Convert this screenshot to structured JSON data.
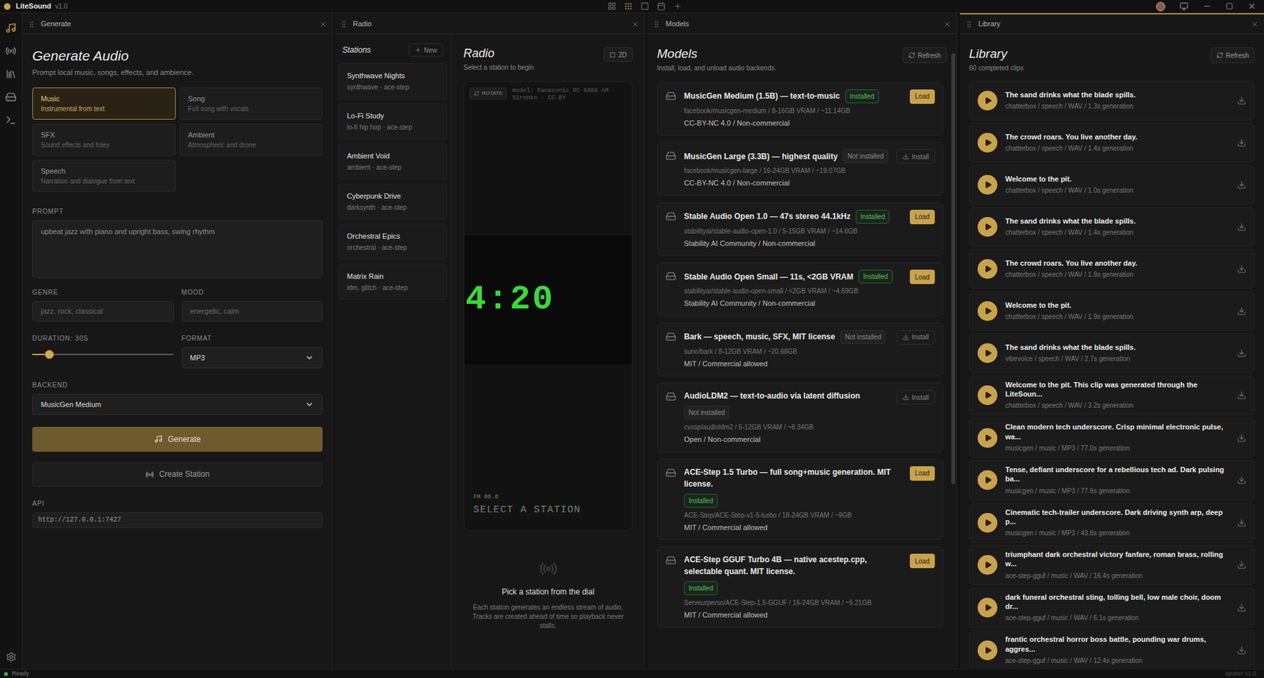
{
  "window": {
    "title": "LiteSound",
    "version": "v1.0"
  },
  "layout_buttons": [
    {
      "selected": false
    },
    {
      "selected": true
    },
    {
      "selected": false
    },
    {
      "selected": false
    },
    {
      "selected": false
    }
  ],
  "rail": {
    "items": [
      {
        "selected": true
      },
      {
        "selected": false
      },
      {
        "selected": false
      },
      {
        "selected": false
      },
      {
        "selected": false
      }
    ]
  },
  "generate": {
    "panel_title": "Generate",
    "focused": false,
    "title": "Generate Audio",
    "subtitle": "Prompt local music, songs, effects, and ambience.",
    "modes": [
      {
        "label": "Music",
        "hint": "Instrumental from text",
        "selected": true
      },
      {
        "label": "Song",
        "hint": "Full song with vocals",
        "selected": false
      },
      {
        "label": "SFX",
        "hint": "Sound effects and foley",
        "selected": false
      },
      {
        "label": "Ambient",
        "hint": "Atmospheric and drone",
        "selected": false
      },
      {
        "label": "Speech",
        "hint": "Narration and dialogue from text",
        "selected": false
      }
    ],
    "prompt": {
      "label": "PROMPT",
      "placeholder": "upbeat jazz with piano and upright bass, swing rhythm"
    },
    "genre": {
      "label": "GENRE",
      "placeholder": "jazz, rock, classical"
    },
    "mood": {
      "label": "MOOD",
      "placeholder": "energetic, calm"
    },
    "duration": {
      "label": "DURATION: 30S",
      "level": 0.12
    },
    "format": {
      "label": "FORMAT",
      "value": "MP3"
    },
    "backend": {
      "label": "BACKEND",
      "value": "MusicGen Medium"
    },
    "generate_button": "Generate",
    "station_button": "Create Station",
    "api": {
      "label": "API",
      "value": "http://127.0.0.1:7427"
    }
  },
  "radio": {
    "panel_title": "Radio",
    "focused": false,
    "stations_title": "Stations",
    "new_button": "New",
    "stations": [
      {
        "name": "Synthwave Nights",
        "meta": "synthwave · ace-step",
        "selected": false
      },
      {
        "name": "Lo-Fi Study",
        "meta": "lo-fi hip hop · ace-step",
        "selected": false
      },
      {
        "name": "Ambient Void",
        "meta": "ambient · ace-step",
        "selected": false
      },
      {
        "name": "Cyberpunk Drive",
        "meta": "darksynth · ace-step",
        "selected": false
      },
      {
        "name": "Orchestral Epics",
        "meta": "orchestral · ace-step",
        "selected": false
      },
      {
        "name": "Matrix Rain",
        "meta": "idm, glitch · ace-step",
        "selected": false
      }
    ],
    "title": "Radio",
    "subtitle": "Select a station to begin",
    "view_button": "2D",
    "rotate_button": "ROTATE",
    "credit": "model: Panasonic RC 6088 AM · Sirenko · CC-BY",
    "clock": "4:20",
    "frequency": "FM 00.0",
    "status": "SELECT A STATION",
    "empty_title": "Pick a station from the dial",
    "empty_text": "Each station generates an endless stream of audio. Tracks are created ahead of time so playback never stalls."
  },
  "models": {
    "panel_title": "Models",
    "focused": false,
    "title": "Models",
    "subtitle": "Install, load, and unload audio backends.",
    "refresh": "Refresh",
    "scroll_level": 0.7,
    "items": [
      {
        "name": "MusicGen Medium (1.5B) — text-to-music",
        "installed": true,
        "badge": "Installed",
        "repo": "facebook/musicgen-medium / 8-16GB VRAM / ~11.14GB",
        "license": "CC-BY-NC 4.0 / Non-commercial",
        "action": "Load"
      },
      {
        "name": "MusicGen Large (3.3B) — highest quality",
        "installed": false,
        "badge": "Not installed",
        "repo": "facebook/musicgen-large / 16-24GB VRAM / ~19.07GB",
        "license": "CC-BY-NC 4.0 / Non-commercial",
        "action": "Install"
      },
      {
        "name": "Stable Audio Open 1.0 — 47s stereo 44.1kHz",
        "installed": true,
        "badge": "Installed",
        "repo": "stabilityai/stable-audio-open-1.0 / 5-15GB VRAM / ~14.6GB",
        "license": "Stability AI Community / Non-commercial",
        "action": "Load"
      },
      {
        "name": "Stable Audio Open Small — 11s, <2GB VRAM",
        "installed": true,
        "badge": "Installed",
        "repo": "stabilityai/stable-audio-open-small / <2GB VRAM / ~4.69GB",
        "license": "Stability AI Community / Non-commercial",
        "action": "Load"
      },
      {
        "name": "Bark — speech, music, SFX, MIT license",
        "installed": false,
        "badge": "Not installed",
        "repo": "suno/bark / 8-12GB VRAM / ~20.68GB",
        "license": "MIT / Commercial allowed",
        "action": "Install"
      },
      {
        "name": "AudioLDM2 — text-to-audio via latent diffusion",
        "installed": false,
        "badge": "Not installed",
        "repo": "cvssp/audioldm2 / 6-12GB VRAM / ~8.34GB",
        "license": "Open / Non-commercial",
        "action": "Install"
      },
      {
        "name": "ACE-Step 1.5 Turbo — full song+music generation. MIT license.",
        "installed": true,
        "badge": "Installed",
        "repo": "ACE-Step/ACE-Step-v1-5-turbo / 18-24GB VRAM / ~9GB",
        "license": "MIT / Commercial allowed",
        "action": "Load"
      },
      {
        "name": "ACE-Step GGUF Turbo 4B — native acestep.cpp, selectable quant. MIT license.",
        "installed": true,
        "badge": "Installed",
        "repo": "Serveurperso/ACE-Step-1.5-GGUF / 16-24GB VRAM / ~5.21GB",
        "license": "MIT / Commercial allowed",
        "action": "Load"
      }
    ]
  },
  "library": {
    "panel_title": "Library",
    "focused": true,
    "title": "Library",
    "subtitle": "60 completed clips",
    "refresh": "Refresh",
    "clips": [
      {
        "title": "The sand drinks what the blade spills.",
        "meta": "chatterbox / speech / WAV / 1.3s generation"
      },
      {
        "title": "The crowd roars. You live another day.",
        "meta": "chatterbox / speech / WAV / 1.4s generation"
      },
      {
        "title": "Welcome to the pit.",
        "meta": "chatterbox / speech / WAV / 1.0s generation"
      },
      {
        "title": "The sand drinks what the blade spills.",
        "meta": "chatterbox / speech / WAV / 1.4s generation"
      },
      {
        "title": "The crowd roars. You live another day.",
        "meta": "chatterbox / speech / WAV / 1.9s generation"
      },
      {
        "title": "Welcome to the pit.",
        "meta": "chatterbox / speech / WAV / 1.9s generation"
      },
      {
        "title": "The sand drinks what the blade spills.",
        "meta": "vibevoice / speech / WAV / 2.7s generation"
      },
      {
        "title": "Welcome to the pit. This clip was generated through the LiteSoun...",
        "meta": "chatterbox / speech / WAV / 3.2s generation"
      },
      {
        "title": "Clean modern tech underscore. Crisp minimal electronic pulse, wa...",
        "meta": "musicgen / music / MP3 / 77.0s generation"
      },
      {
        "title": "Tense, defiant underscore for a rebellious tech ad. Dark pulsing ba...",
        "meta": "musicgen / music / MP3 / 77.6s generation"
      },
      {
        "title": "Cinematic tech-trailer underscore. Dark driving synth arp, deep p...",
        "meta": "musicgen / music / MP3 / 43.6s generation"
      },
      {
        "title": "triumphant dark orchestral victory fanfare, roman brass, rolling w...",
        "meta": "ace-step-gguf / music / WAV / 16.4s generation"
      },
      {
        "title": "dark funeral orchestral sting, tolling bell, low male choir, doom dr...",
        "meta": "ace-step-gguf / music / WAV / 6.1s generation"
      },
      {
        "title": "frantic orchestral horror boss battle, pounding war drums, aggres...",
        "meta": "ace-step-gguf / music / WAV / 12.4s generation"
      }
    ]
  },
  "status_bar": {
    "text": "Ready",
    "right": "sputter v1.0",
    "ok": true
  }
}
